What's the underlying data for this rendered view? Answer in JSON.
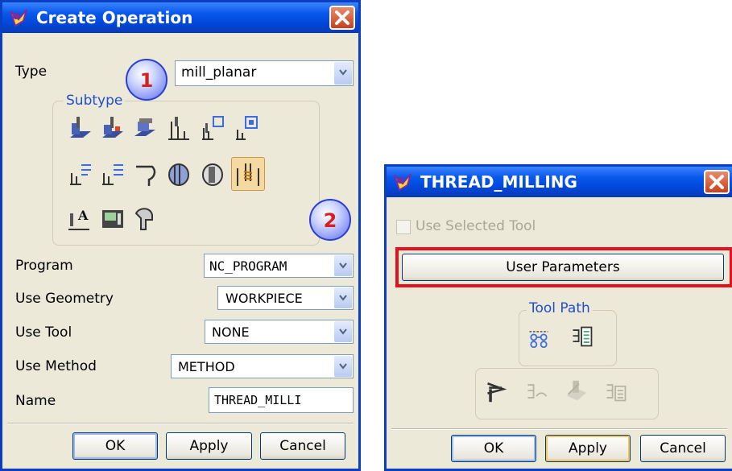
{
  "create_operation": {
    "title": "Create Operation",
    "type_label": "Type",
    "type_value": "mill_planar",
    "subtype_label": "Subtype",
    "program_label": "Program",
    "program_value": "NC_PROGRAM",
    "geometry_label": "Use Geometry",
    "geometry_value": "WORKPIECE",
    "tool_label": "Use Tool",
    "tool_value": "NONE",
    "method_label": "Use Method",
    "method_value": "METHOD",
    "name_label": "Name",
    "name_value": "THREAD_MILLI",
    "ok": "OK",
    "apply": "Apply",
    "cancel": "Cancel",
    "callout_1": "1",
    "callout_2": "2",
    "subtype_icons": [
      "floor-wall-icon",
      "floor-wall-ipw-icon",
      "face-milling-icon",
      "planar-mill-icon",
      "planar-profile-icon",
      "cleanup-corners-icon",
      "finish-walls-icon",
      "finish-floor-icon",
      "groove-milling-icon",
      "hole-milling-icon",
      "boss-milling-icon",
      "thread-milling-icon",
      "planar-text-icon",
      "mill-control-icon",
      "mill-user-icon"
    ]
  },
  "thread_milling": {
    "title": "THREAD_MILLING",
    "use_selected_tool": "Use Selected Tool",
    "user_parameters": "User Parameters",
    "tool_path_label": "Tool Path",
    "ok": "OK",
    "apply": "Apply",
    "cancel": "Cancel",
    "highlight_color": "#e8101c"
  }
}
